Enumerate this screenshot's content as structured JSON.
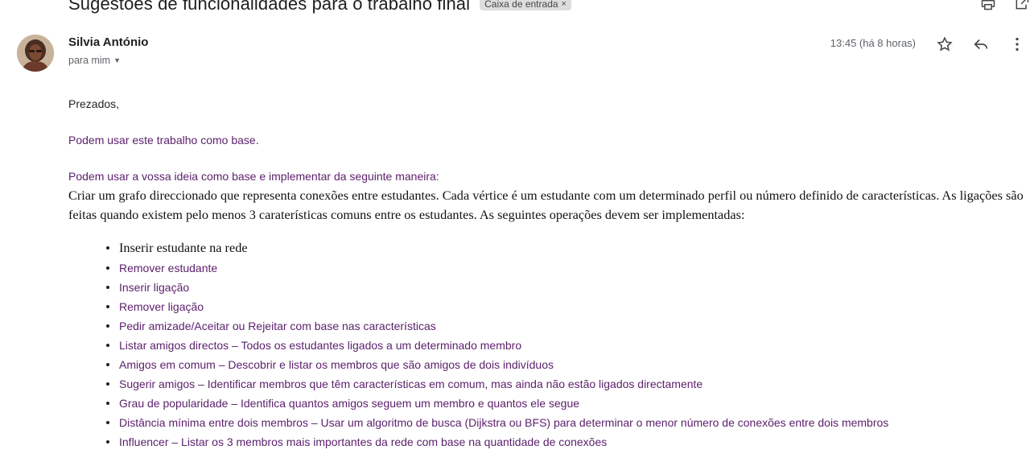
{
  "subject": {
    "title": "Sugestões de funcionalidades para o trabalho final",
    "label": "Caixa de entrada",
    "label_close": "×"
  },
  "sender": {
    "name": "Silvia António",
    "recipient": "para mim",
    "time": "13:45 (há 8 horas)"
  },
  "icons": [
    "print-icon",
    "open-in-new-window-icon",
    "star-icon",
    "reply-icon",
    "more-options-icon",
    "chevron-down-icon"
  ],
  "body": {
    "greeting": "Prezados,",
    "paragraph1": "Podem usar este trabalho como base.",
    "paragraph2": "Podem usar a vossa ideia como base e implementar da seguinte maneira:",
    "description": "Criar um grafo direccionado que representa conexões entre estudantes. Cada vértice é um estudante com um determinado perfil ou número definido de características. As ligações são feitas quando existem pelo menos 3 caraterísticas comuns entre os estudantes. As seguintes operações devem ser implementadas:",
    "operations": [
      "Inserir estudante na rede",
      "Remover estudante",
      "Inserir ligação",
      "Remover ligação",
      "Pedir amizade/Aceitar ou Rejeitar com base nas características",
      "Listar amigos directos – Todos os estudantes ligados a um determinado membro",
      "Amigos em comum – Descobrir e listar os membros que são amigos de dois indivíduos",
      "Sugerir amigos – Identificar membros que têm características em comum, mas ainda não estão ligados directamente",
      "Grau de popularidade – Identifica quantos amigos seguem um membro e quantos ele segue",
      "Distância mínima entre dois membros – Usar um algoritmo de busca (Dijkstra ou BFS) para determinar o menor número de conexões entre dois membros",
      "Influencer – Listar os 3 membros mais importantes da rede com base na quantidade de conexões"
    ]
  },
  "colors": {
    "link_purple": "#5b1f6b",
    "muted": "#5f6368",
    "chip_bg": "#dddddd"
  }
}
